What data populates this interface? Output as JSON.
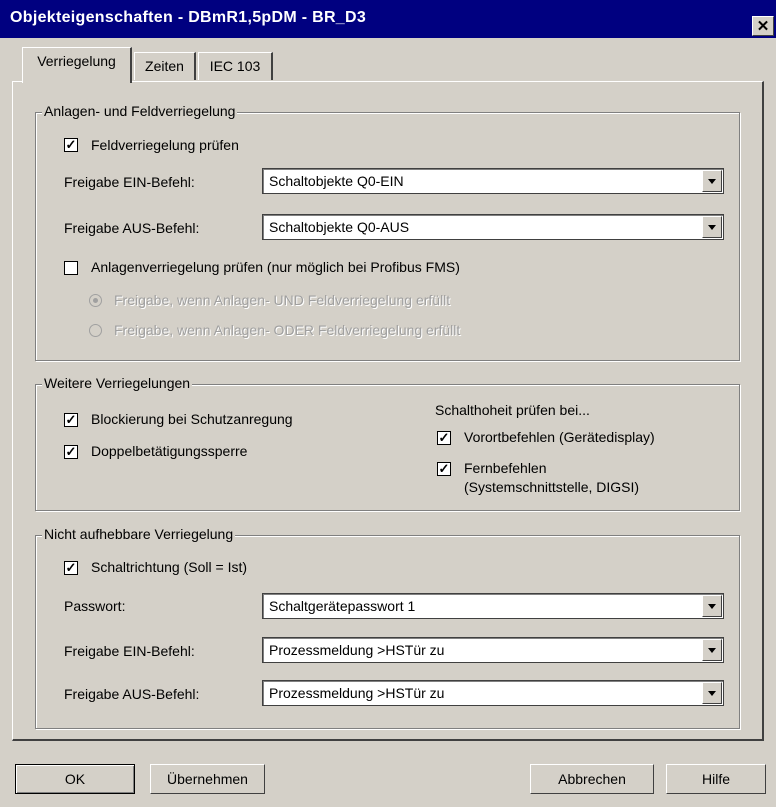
{
  "window": {
    "title": "Objekteigenschaften - DBmR1,5pDM - BR_D3",
    "close_label": "✕"
  },
  "tabs": [
    {
      "label": "Verriegelung"
    },
    {
      "label": "Zeiten"
    },
    {
      "label": "IEC 103"
    }
  ],
  "group1": {
    "title": "Anlagen- und Feldverriegelung",
    "feld_check": {
      "label": "Feldverriegelung prüfen",
      "checked": true
    },
    "ein": {
      "label": "Freigabe EIN-Befehl:",
      "value": "Schaltobjekte    Q0-EIN"
    },
    "aus": {
      "label": "Freigabe AUS-Befehl:",
      "value": "Schaltobjekte    Q0-AUS"
    },
    "anlagen_check": {
      "label": "Anlagenverriegelung prüfen (nur möglich bei Profibus FMS)",
      "checked": false
    },
    "radio_und": {
      "label": "Freigabe, wenn Anlagen- UND Feldverriegelung erfüllt",
      "selected": true
    },
    "radio_oder": {
      "label": "Freigabe, wenn Anlagen- ODER Feldverriegelung erfüllt",
      "selected": false
    }
  },
  "group2": {
    "title": "Weitere Verriegelungen",
    "blockierung": {
      "label": "Blockierung bei Schutzanregung",
      "checked": true
    },
    "doppel": {
      "label": "Doppelbetätigungssperre",
      "checked": true
    },
    "schalthoheit_title": "Schalthoheit prüfen bei...",
    "vorort": {
      "label": "Vorortbefehlen (Gerätedisplay)",
      "checked": true
    },
    "fern": {
      "label_line1": "Fernbefehlen",
      "label_line2": "(Systemschnittstelle, DIGSI)",
      "checked": true
    }
  },
  "group3": {
    "title": "Nicht aufhebbare Verriegelung",
    "schaltrichtung": {
      "label": "Schaltrichtung (Soll = Ist)",
      "checked": true
    },
    "passwort": {
      "label": "Passwort:",
      "value": "Schaltgerätepasswort  1"
    },
    "ein": {
      "label": "Freigabe EIN-Befehl:",
      "value": "Prozessmeldung    >HSTür zu"
    },
    "aus": {
      "label": "Freigabe AUS-Befehl:",
      "value": "Prozessmeldung    >HSTür zu"
    }
  },
  "buttons": {
    "ok": "OK",
    "apply": "Übernehmen",
    "cancel": "Abbrechen",
    "help": "Hilfe"
  },
  "check_glyph": "✓"
}
